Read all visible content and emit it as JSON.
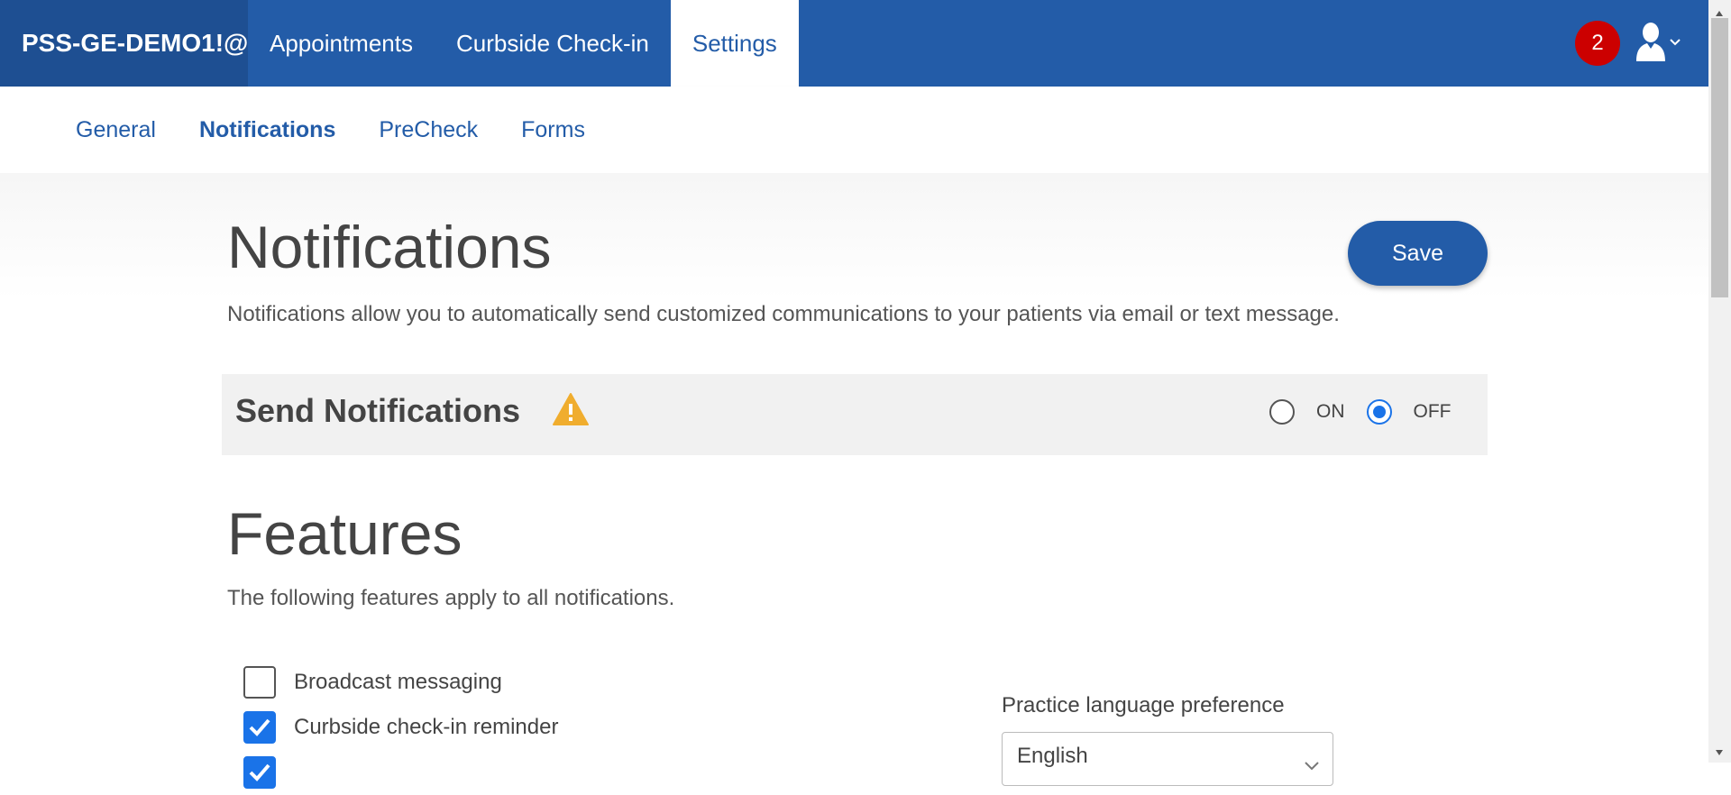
{
  "header": {
    "brand": "PSS-GE-DEMO1!@",
    "nav": [
      {
        "label": "Appointments",
        "active": false
      },
      {
        "label": "Curbside Check-in",
        "active": false
      },
      {
        "label": "Settings",
        "active": true
      }
    ],
    "notification_count": "2",
    "icons": {
      "user": "user-avatar-icon",
      "dropdown": "chevron-down-icon"
    }
  },
  "subnav": {
    "items": [
      {
        "label": "General",
        "active": false
      },
      {
        "label": "Notifications",
        "active": true
      },
      {
        "label": "PreCheck",
        "active": false
      },
      {
        "label": "Forms",
        "active": false
      }
    ]
  },
  "page": {
    "title": "Notifications",
    "description": "Notifications allow you to automatically send customized communications to your patients via email or text message.",
    "save_label": "Save"
  },
  "send_notifications": {
    "title": "Send Notifications",
    "warning_icon": "warning-triangle-icon",
    "options": [
      {
        "label": "ON",
        "selected": false
      },
      {
        "label": "OFF",
        "selected": true
      }
    ]
  },
  "features": {
    "title": "Features",
    "description": "The following features apply to all notifications.",
    "items": [
      {
        "label": "Broadcast messaging",
        "checked": false
      },
      {
        "label": "Curbside check-in reminder",
        "checked": true
      },
      {
        "label": "",
        "checked": true
      }
    ],
    "language": {
      "label": "Practice language preference",
      "value": "English"
    }
  },
  "colors": {
    "primary": "#235ca8",
    "brand_bg": "#1e4f92",
    "badge": "#cc0000",
    "accent": "#1a73e8",
    "warning": "#f0ad2e"
  }
}
